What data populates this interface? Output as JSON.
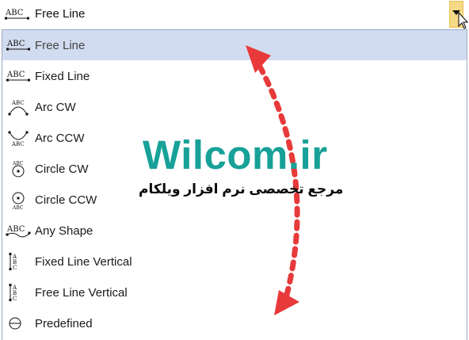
{
  "selected_value": "Free Line",
  "items": [
    {
      "label": "Free Line",
      "icon": "abc-free-line-icon",
      "selected": true
    },
    {
      "label": "Fixed Line",
      "icon": "abc-fixed-line-icon",
      "selected": false
    },
    {
      "label": "Arc CW",
      "icon": "abc-arc-cw-icon",
      "selected": false
    },
    {
      "label": "Arc CCW",
      "icon": "abc-arc-ccw-icon",
      "selected": false
    },
    {
      "label": "Circle CW",
      "icon": "abc-circle-cw-icon",
      "selected": false
    },
    {
      "label": "Circle CCW",
      "icon": "abc-circle-ccw-icon",
      "selected": false
    },
    {
      "label": "Any Shape",
      "icon": "abc-any-shape-icon",
      "selected": false
    },
    {
      "label": "Fixed Line Vertical",
      "icon": "abc-fixed-vertical-icon",
      "selected": false
    },
    {
      "label": "Free Line Vertical",
      "icon": "abc-free-vertical-icon",
      "selected": false
    },
    {
      "label": "Predefined",
      "icon": "predefined-circle-icon",
      "selected": false
    }
  ],
  "watermark": {
    "brand": "Wilcom.ir",
    "subtitle": "مرجع تخصصی نرم افزار ویلکام",
    "brand_color": "#17a198",
    "arrow_color": "#e83a3a"
  },
  "colors": {
    "selection_bg": "#d2dcf0",
    "dropdown_button": "#f4d987",
    "list_border": "#9aa8c4"
  }
}
